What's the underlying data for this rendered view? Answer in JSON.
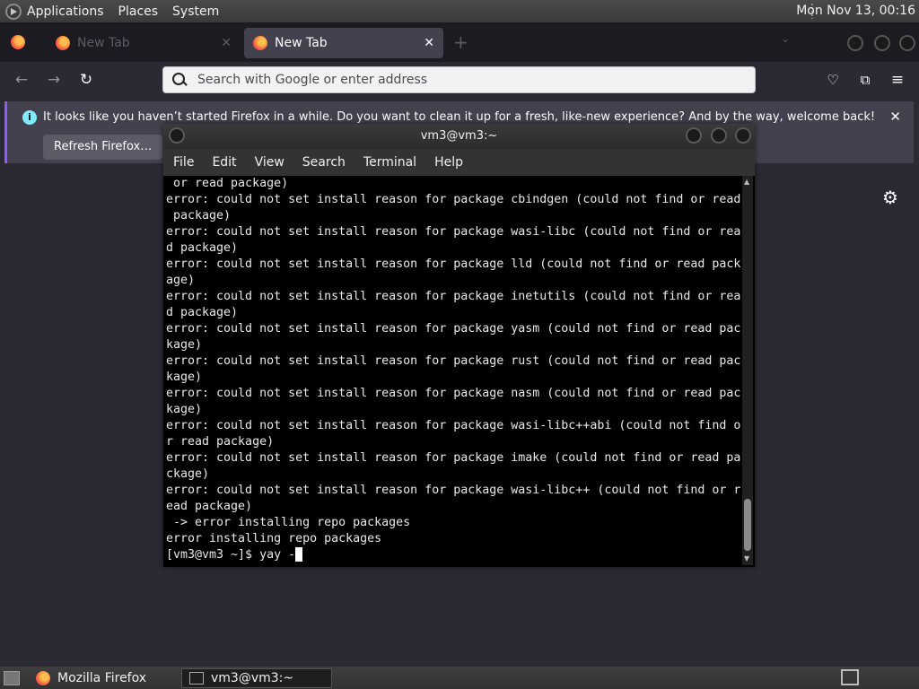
{
  "system_panel": {
    "menus": [
      "Applications",
      "Places",
      "System"
    ],
    "clock": "Mon Nov 13, 00:16"
  },
  "browser": {
    "tabs": [
      {
        "label": "New Tab",
        "active": false
      },
      {
        "label": "New Tab",
        "active": true
      }
    ],
    "url_placeholder": "Search with Google or enter address",
    "notification": {
      "message": "It looks like you haven’t started Firefox in a while. Do you want to clean it up for a fresh, like-new experience? And by the way, welcome back!",
      "button": "Refresh Firefox…"
    }
  },
  "terminal": {
    "title": "vm3@vm3:~",
    "menus": [
      "File",
      "Edit",
      "View",
      "Search",
      "Terminal",
      "Help"
    ],
    "lines": [
      " or read package)",
      "error: could not set install reason for package cbindgen (could not find or read",
      " package)",
      "error: could not set install reason for package wasi-libc (could not find or rea",
      "d package)",
      "error: could not set install reason for package lld (could not find or read pack",
      "age)",
      "error: could not set install reason for package inetutils (could not find or rea",
      "d package)",
      "error: could not set install reason for package yasm (could not find or read pac",
      "kage)",
      "error: could not set install reason for package rust (could not find or read pac",
      "kage)",
      "error: could not set install reason for package nasm (could not find or read pac",
      "kage)",
      "error: could not set install reason for package wasi-libc++abi (could not find o",
      "r read package)",
      "error: could not set install reason for package imake (could not find or read pa",
      "ckage)",
      "error: could not set install reason for package wasi-libc++ (could not find or r",
      "ead package)",
      " -> error installing repo packages",
      "error installing repo packages"
    ],
    "prompt": "[vm3@vm3 ~]$ yay -"
  },
  "taskbar": {
    "items": [
      "Mozilla Firefox",
      "vm3@vm3:~"
    ]
  }
}
